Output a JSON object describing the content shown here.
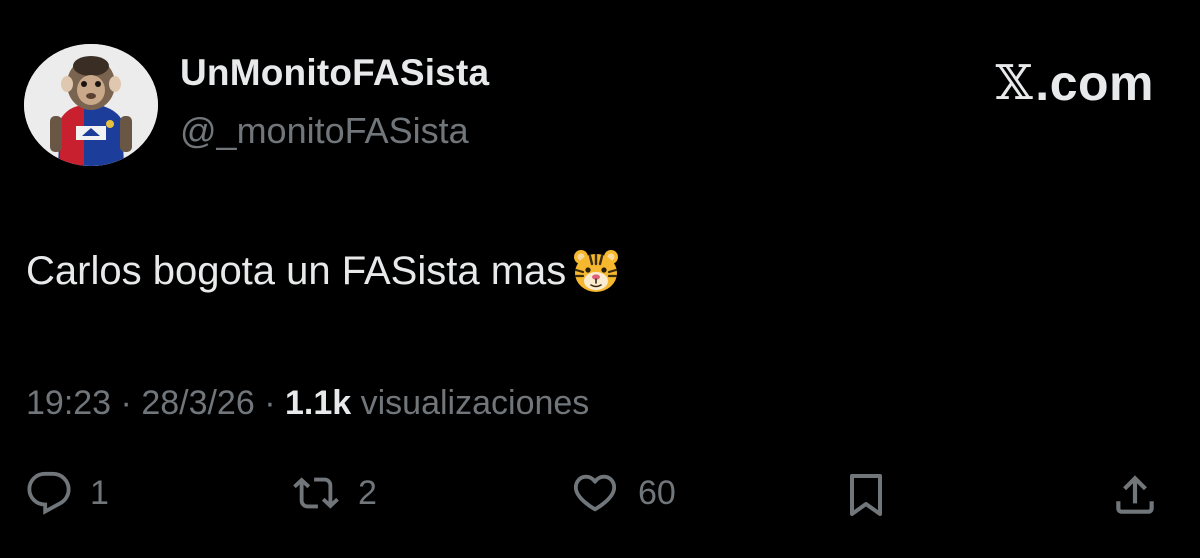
{
  "author": {
    "display_name": "UnMonitoFASista",
    "handle": "@_monitoFASista"
  },
  "brand": {
    "glyph": "𝕏",
    "label": ".com"
  },
  "tweet": {
    "text": "Carlos bogota un FASista mas",
    "emoji": "tiger-face-icon"
  },
  "meta": {
    "time": "19:23",
    "separator": " · ",
    "date": "28/3/26",
    "views_count": "1.1k",
    "views_label": "visualizaciones"
  },
  "actions": {
    "replies": "1",
    "reposts": "2",
    "likes": "60"
  },
  "colors": {
    "background": "#000000",
    "text_primary": "#e7e9ea",
    "text_secondary": "#71767b"
  }
}
